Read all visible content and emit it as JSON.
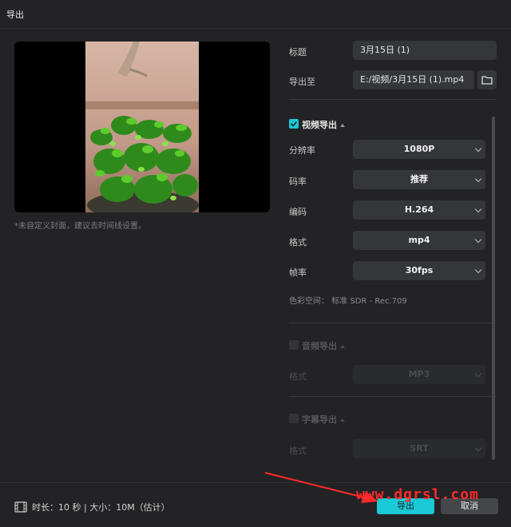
{
  "window": {
    "title": "导出"
  },
  "preview": {
    "cover_note": "*未自定义封面，建议去时间线设置。"
  },
  "form": {
    "title_label": "标题",
    "title_value": "3月15日 (1)",
    "export_to_label": "导出至",
    "export_to_value": "E:/视频/3月15日 (1).mp4"
  },
  "video_export": {
    "section_title": "视频导出",
    "checked": true,
    "resolution_label": "分辨率",
    "resolution_value": "1080P",
    "bitrate_label": "码率",
    "bitrate_value": "推荐",
    "codec_label": "编码",
    "codec_value": "H.264",
    "format_label": "格式",
    "format_value": "mp4",
    "framerate_label": "帧率",
    "framerate_value": "30fps",
    "color_space": "色彩空间： 标准 SDR - Rec.709"
  },
  "audio_export": {
    "section_title": "音频导出",
    "checked": false,
    "format_label": "格式",
    "format_value": "MP3"
  },
  "subtitle_export": {
    "section_title": "字幕导出",
    "checked": false,
    "format_label": "格式",
    "format_value": "SRT"
  },
  "footer": {
    "info": "时长：10 秒 | 大小：10M（估计）",
    "export_label": "导出",
    "cancel_label": "取消"
  },
  "watermark": "www.dgrsl.com",
  "colors": {
    "accent": "#19c9d6",
    "background": "#232325",
    "annotation": "#ff2a2a"
  }
}
